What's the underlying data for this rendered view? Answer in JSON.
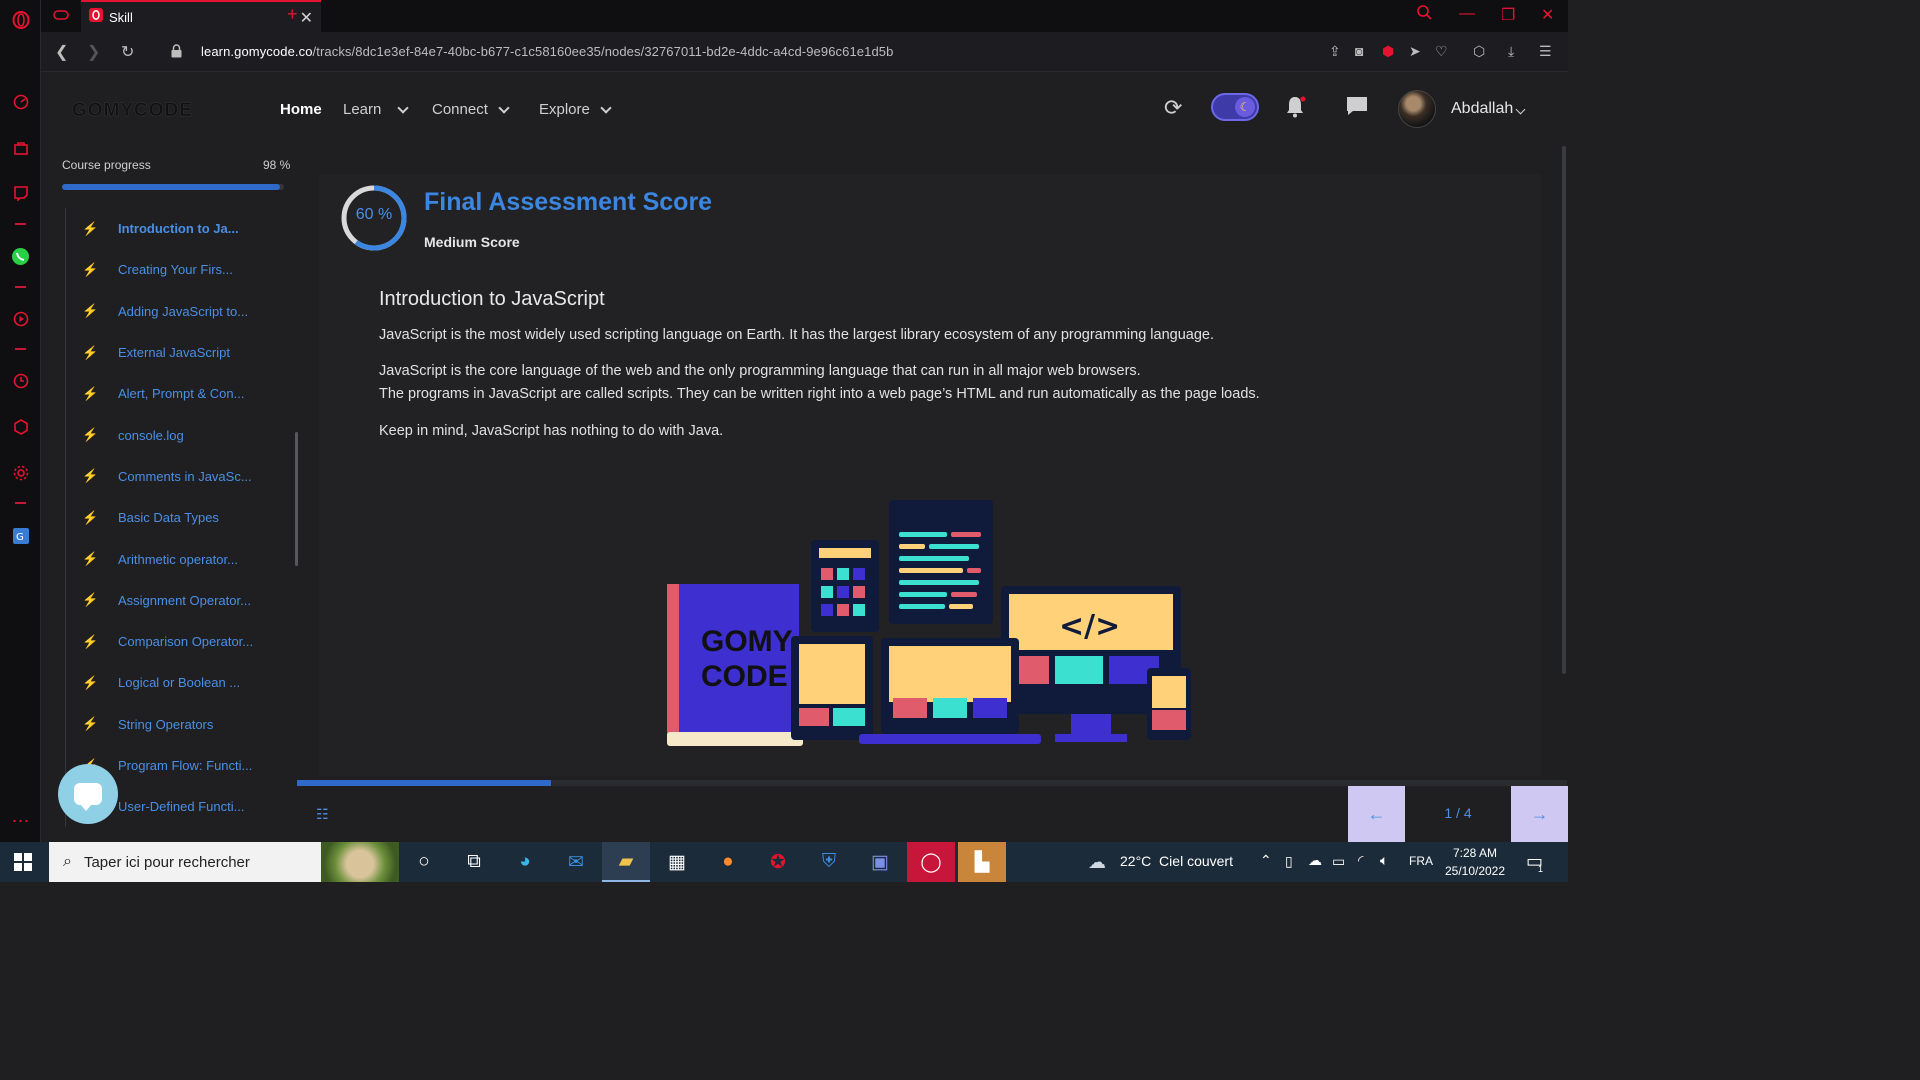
{
  "browser": {
    "tab_title": "Skill",
    "url_host": "learn.gomycode.co",
    "url_path": "/tracks/8dc1e3ef-84e7-40bc-b677-c1c58160ee35/nodes/32767011-bd2e-4ddc-a4cd-9e96c61e1d5b"
  },
  "header": {
    "logo": "GOMYCODE",
    "nav": {
      "home": "Home",
      "learn": "Learn",
      "connect": "Connect",
      "explore": "Explore"
    },
    "username": "Abdallah"
  },
  "sidebar": {
    "progress_label": "Course progress",
    "progress_value": "98 %",
    "progress_fraction": 0.98,
    "lessons": [
      "Introduction to Ja...",
      "Creating Your Firs...",
      "Adding JavaScript to...",
      "External JavaScript",
      "Alert, Prompt & Con...",
      "console.log",
      "Comments in JavaSc...",
      "Basic Data Types",
      "Arithmetic operator...",
      "Assignment Operator...",
      "Comparison Operator...",
      "Logical or Boolean ...",
      "String Operators",
      "Program Flow: Functi...",
      "User-Defined Functi..."
    ]
  },
  "score": {
    "percent_label": "60 %",
    "percent": 60,
    "title": "Final Assessment Score",
    "subtitle": "Medium Score"
  },
  "lesson": {
    "title": "Introduction to JavaScript",
    "p1": "JavaScript is the most widely used scripting language on Earth. It has the largest library ecosystem of any programming language.",
    "p2a": "JavaScript is the core language of the web and the only programming language that can run in all major web browsers.",
    "p2b": "The programs in JavaScript are called scripts. They can be written right into a web page’s HTML and run automatically as the page loads.",
    "p3": "Keep in mind, JavaScript has nothing to do with Java.",
    "illustration_book_line1": "GOMY",
    "illustration_book_line2": "CODE",
    "illustration_code_tag": "</>"
  },
  "pager": {
    "count": "1 / 4",
    "prev": "←",
    "next": "→",
    "slide_progress_fraction": 0.2
  },
  "taskbar": {
    "search_placeholder": "Taper ici pour rechercher",
    "weather": "22°C  Ciel couvert",
    "lang": "FRA",
    "time": "7:28 AM",
    "date": "25/10/2022",
    "notif_count": "1"
  },
  "colors": {
    "accent": "#3b86e0",
    "brand_red": "#e5132f",
    "progress": "#2f69c9"
  }
}
